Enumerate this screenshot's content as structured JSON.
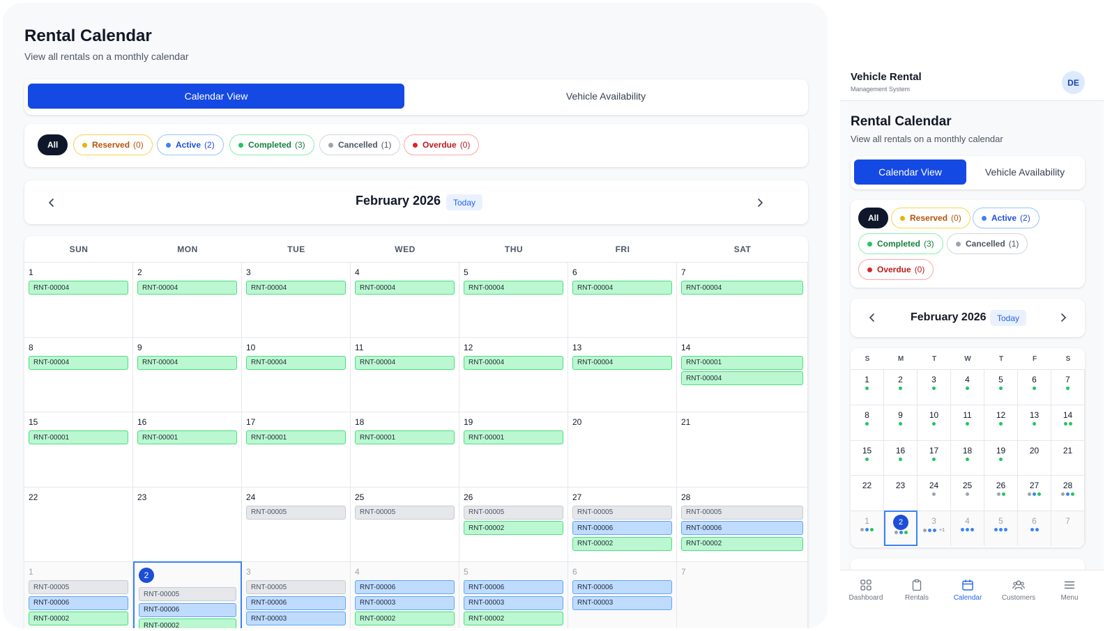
{
  "desktop": {
    "title": "Rental Calendar",
    "subtitle": "View all rentals on a monthly calendar",
    "tabs": [
      {
        "label": "Calendar View",
        "active": true
      },
      {
        "label": "Vehicle Availability",
        "active": false
      }
    ],
    "filters": [
      {
        "key": "all",
        "label": "All",
        "count": null
      },
      {
        "key": "reserved",
        "label": "Reserved",
        "count": "(0)"
      },
      {
        "key": "active",
        "label": "Active",
        "count": "(2)"
      },
      {
        "key": "completed",
        "label": "Completed",
        "count": "(3)"
      },
      {
        "key": "cancelled",
        "label": "Cancelled",
        "count": "(1)"
      },
      {
        "key": "overdue",
        "label": "Overdue",
        "count": "(0)"
      }
    ],
    "month_label": "February 2026",
    "today_label": "Today",
    "weekdays": [
      "SUN",
      "MON",
      "TUE",
      "WED",
      "THU",
      "FRI",
      "SAT"
    ],
    "weeks": [
      [
        {
          "day": "1",
          "events": [
            {
              "id": "RNT-00004",
              "status": "completed"
            }
          ]
        },
        {
          "day": "2",
          "events": [
            {
              "id": "RNT-00004",
              "status": "completed"
            }
          ]
        },
        {
          "day": "3",
          "events": [
            {
              "id": "RNT-00004",
              "status": "completed"
            }
          ]
        },
        {
          "day": "4",
          "events": [
            {
              "id": "RNT-00004",
              "status": "completed"
            }
          ]
        },
        {
          "day": "5",
          "events": [
            {
              "id": "RNT-00004",
              "status": "completed"
            }
          ]
        },
        {
          "day": "6",
          "events": [
            {
              "id": "RNT-00004",
              "status": "completed"
            }
          ]
        },
        {
          "day": "7",
          "events": [
            {
              "id": "RNT-00004",
              "status": "completed"
            }
          ]
        }
      ],
      [
        {
          "day": "8",
          "events": [
            {
              "id": "RNT-00004",
              "status": "completed"
            }
          ]
        },
        {
          "day": "9",
          "events": [
            {
              "id": "RNT-00004",
              "status": "completed"
            }
          ]
        },
        {
          "day": "10",
          "events": [
            {
              "id": "RNT-00004",
              "status": "completed"
            }
          ]
        },
        {
          "day": "11",
          "events": [
            {
              "id": "RNT-00004",
              "status": "completed"
            }
          ]
        },
        {
          "day": "12",
          "events": [
            {
              "id": "RNT-00004",
              "status": "completed"
            }
          ]
        },
        {
          "day": "13",
          "events": [
            {
              "id": "RNT-00004",
              "status": "completed"
            }
          ]
        },
        {
          "day": "14",
          "events": [
            {
              "id": "RNT-00001",
              "status": "completed"
            },
            {
              "id": "RNT-00004",
              "status": "completed"
            }
          ]
        }
      ],
      [
        {
          "day": "15",
          "events": [
            {
              "id": "RNT-00001",
              "status": "completed"
            }
          ]
        },
        {
          "day": "16",
          "events": [
            {
              "id": "RNT-00001",
              "status": "completed"
            }
          ]
        },
        {
          "day": "17",
          "events": [
            {
              "id": "RNT-00001",
              "status": "completed"
            }
          ]
        },
        {
          "day": "18",
          "events": [
            {
              "id": "RNT-00001",
              "status": "completed"
            }
          ]
        },
        {
          "day": "19",
          "events": [
            {
              "id": "RNT-00001",
              "status": "completed"
            }
          ]
        },
        {
          "day": "20",
          "events": []
        },
        {
          "day": "21",
          "events": []
        }
      ],
      [
        {
          "day": "22",
          "events": []
        },
        {
          "day": "23",
          "events": []
        },
        {
          "day": "24",
          "events": [
            {
              "id": "RNT-00005",
              "status": "cancelled"
            }
          ]
        },
        {
          "day": "25",
          "events": [
            {
              "id": "RNT-00005",
              "status": "cancelled"
            }
          ]
        },
        {
          "day": "26",
          "events": [
            {
              "id": "RNT-00005",
              "status": "cancelled"
            },
            {
              "id": "RNT-00002",
              "status": "completed"
            }
          ]
        },
        {
          "day": "27",
          "events": [
            {
              "id": "RNT-00005",
              "status": "cancelled"
            },
            {
              "id": "RNT-00006",
              "status": "active"
            },
            {
              "id": "RNT-00002",
              "status": "completed"
            }
          ]
        },
        {
          "day": "28",
          "events": [
            {
              "id": "RNT-00005",
              "status": "cancelled"
            },
            {
              "id": "RNT-00006",
              "status": "active"
            },
            {
              "id": "RNT-00002",
              "status": "completed"
            }
          ]
        }
      ],
      [
        {
          "day": "1",
          "out": true,
          "events": [
            {
              "id": "RNT-00005",
              "status": "cancelled"
            },
            {
              "id": "RNT-00006",
              "status": "active"
            },
            {
              "id": "RNT-00002",
              "status": "completed"
            }
          ]
        },
        {
          "day": "2",
          "out": true,
          "today": true,
          "events": [
            {
              "id": "RNT-00005",
              "status": "cancelled"
            },
            {
              "id": "RNT-00006",
              "status": "active"
            },
            {
              "id": "RNT-00002",
              "status": "completed"
            }
          ]
        },
        {
          "day": "3",
          "out": true,
          "events": [
            {
              "id": "RNT-00005",
              "status": "cancelled"
            },
            {
              "id": "RNT-00006",
              "status": "active"
            },
            {
              "id": "RNT-00003",
              "status": "active"
            }
          ]
        },
        {
          "day": "4",
          "out": true,
          "events": [
            {
              "id": "RNT-00006",
              "status": "active"
            },
            {
              "id": "RNT-00003",
              "status": "active"
            },
            {
              "id": "RNT-00002",
              "status": "completed"
            }
          ]
        },
        {
          "day": "5",
          "out": true,
          "events": [
            {
              "id": "RNT-00006",
              "status": "active"
            },
            {
              "id": "RNT-00003",
              "status": "active"
            },
            {
              "id": "RNT-00002",
              "status": "completed"
            }
          ]
        },
        {
          "day": "6",
          "out": true,
          "events": [
            {
              "id": "RNT-00006",
              "status": "active"
            },
            {
              "id": "RNT-00003",
              "status": "active"
            }
          ]
        },
        {
          "day": "7",
          "out": true,
          "events": []
        }
      ]
    ]
  },
  "mobile": {
    "brand": "Vehicle Rental",
    "brand_sub": "Management System",
    "avatar": "DE",
    "title": "Rental Calendar",
    "subtitle": "View all rentals on a monthly calendar",
    "tabs": [
      {
        "label": "Calendar View",
        "active": true
      },
      {
        "label": "Vehicle Availability",
        "active": false
      }
    ],
    "month_label": "February 2026",
    "today_label": "Today",
    "weekdays": [
      "S",
      "M",
      "T",
      "W",
      "T",
      "F",
      "S"
    ],
    "weeks": [
      [
        {
          "day": "1",
          "dots": [
            "completed"
          ]
        },
        {
          "day": "2",
          "dots": [
            "completed"
          ]
        },
        {
          "day": "3",
          "dots": [
            "completed"
          ]
        },
        {
          "day": "4",
          "dots": [
            "completed"
          ]
        },
        {
          "day": "5",
          "dots": [
            "completed"
          ]
        },
        {
          "day": "6",
          "dots": [
            "completed"
          ]
        },
        {
          "day": "7",
          "dots": [
            "completed"
          ]
        }
      ],
      [
        {
          "day": "8",
          "dots": [
            "completed"
          ]
        },
        {
          "day": "9",
          "dots": [
            "completed"
          ]
        },
        {
          "day": "10",
          "dots": [
            "completed"
          ]
        },
        {
          "day": "11",
          "dots": [
            "completed"
          ]
        },
        {
          "day": "12",
          "dots": [
            "completed"
          ]
        },
        {
          "day": "13",
          "dots": [
            "completed"
          ]
        },
        {
          "day": "14",
          "dots": [
            "completed",
            "completed"
          ]
        }
      ],
      [
        {
          "day": "15",
          "dots": [
            "completed"
          ]
        },
        {
          "day": "16",
          "dots": [
            "completed"
          ]
        },
        {
          "day": "17",
          "dots": [
            "completed"
          ]
        },
        {
          "day": "18",
          "dots": [
            "completed"
          ]
        },
        {
          "day": "19",
          "dots": [
            "completed"
          ]
        },
        {
          "day": "20",
          "dots": []
        },
        {
          "day": "21",
          "dots": []
        }
      ],
      [
        {
          "day": "22",
          "dots": []
        },
        {
          "day": "23",
          "dots": []
        },
        {
          "day": "24",
          "dots": [
            "cancelled"
          ]
        },
        {
          "day": "25",
          "dots": [
            "cancelled"
          ]
        },
        {
          "day": "26",
          "dots": [
            "cancelled",
            "completed"
          ]
        },
        {
          "day": "27",
          "dots": [
            "cancelled",
            "active",
            "completed"
          ]
        },
        {
          "day": "28",
          "dots": [
            "cancelled",
            "active",
            "completed"
          ]
        }
      ],
      [
        {
          "day": "1",
          "out": true,
          "dots": [
            "cancelled",
            "active",
            "completed"
          ]
        },
        {
          "day": "2",
          "out": true,
          "today": true,
          "dots": [
            "cancelled",
            "active",
            "completed"
          ]
        },
        {
          "day": "3",
          "out": true,
          "dots": [
            "cancelled",
            "active",
            "active"
          ],
          "more": "+1"
        },
        {
          "day": "4",
          "out": true,
          "dots": [
            "active",
            "active",
            "active"
          ]
        },
        {
          "day": "5",
          "out": true,
          "dots": [
            "active",
            "active",
            "active"
          ]
        },
        {
          "day": "6",
          "out": true,
          "dots": [
            "active",
            "active"
          ]
        },
        {
          "day": "7",
          "out": true,
          "dots": []
        }
      ]
    ],
    "bottom_nav": [
      {
        "key": "dashboard",
        "label": "Dashboard",
        "icon": "dashboard-icon",
        "active": false
      },
      {
        "key": "rentals",
        "label": "Rentals",
        "icon": "clipboard-icon",
        "active": false
      },
      {
        "key": "calendar",
        "label": "Calendar",
        "icon": "calendar-icon",
        "active": true
      },
      {
        "key": "customers",
        "label": "Customers",
        "icon": "users-icon",
        "active": false
      },
      {
        "key": "menu",
        "label": "Menu",
        "icon": "menu-icon",
        "active": false
      }
    ]
  },
  "colors": {
    "primary": "#1549e3",
    "reserved": "#eab308",
    "active": "#3b82f6",
    "completed": "#22c55e",
    "cancelled": "#9ca3af",
    "overdue": "#dc2626"
  }
}
